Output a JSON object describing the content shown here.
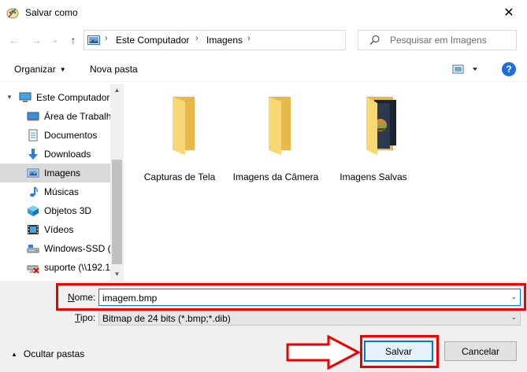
{
  "window": {
    "title": "Salvar como",
    "close_glyph": "✕"
  },
  "nav": {
    "back_glyph": "←",
    "forward_glyph": "→",
    "recent_glyph": "⌄",
    "up_glyph": "↑"
  },
  "address": {
    "crumbs": [
      "Este Computador",
      "Imagens"
    ],
    "sep_glyph": "›",
    "drop_glyph": "⌄",
    "refresh_glyph": "↻"
  },
  "search": {
    "placeholder": "Pesquisar em Imagens"
  },
  "toolbar": {
    "organize_label": "Organizar",
    "new_folder_label": "Nova pasta",
    "help_label": "?"
  },
  "navpane": {
    "root": "Este Computador",
    "items": [
      {
        "label": "Área de Trabalho",
        "icon": "desktop-icon"
      },
      {
        "label": "Documentos",
        "icon": "documents-icon"
      },
      {
        "label": "Downloads",
        "icon": "downloads-icon"
      },
      {
        "label": "Imagens",
        "icon": "pictures-icon",
        "selected": true
      },
      {
        "label": "Músicas",
        "icon": "music-icon"
      },
      {
        "label": "Objetos 3D",
        "icon": "3d-objects-icon"
      },
      {
        "label": "Vídeos",
        "icon": "videos-icon"
      },
      {
        "label": "Windows-SSD (C",
        "icon": "drive-icon"
      },
      {
        "label": "suporte (\\\\192.1(",
        "icon": "network-drive-icon"
      }
    ]
  },
  "folders": [
    {
      "label": "Capturas de Tela"
    },
    {
      "label": "Imagens da Câmera"
    },
    {
      "label": "Imagens Salvas"
    }
  ],
  "form": {
    "name_label_prefix": "N",
    "name_label_rest": "ome:",
    "name_value": "imagem.bmp",
    "type_label_prefix": "T",
    "type_label_rest": "ipo:",
    "type_value": "Bitmap de 24 bits (*.bmp;*.dib)"
  },
  "footer": {
    "hide_folders_label": "Ocultar pastas",
    "save_label": "Salvar",
    "cancel_label": "Cancelar"
  },
  "colors": {
    "accent": "#0078d7",
    "annotation_red": "#e00000",
    "folder_yellow": "#f8d775"
  }
}
